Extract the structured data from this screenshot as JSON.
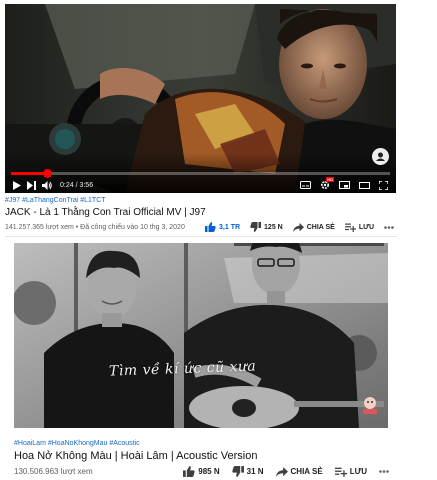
{
  "video1": {
    "progress": 0.096,
    "current_time": "0:24",
    "duration": "3:56",
    "hashtags": "#J97 #LaThangConTrai #L1TCT",
    "title": "JACK - Là 1 Thằng Con Trai Official MV | J97",
    "views": "141.257.365 lượt xem • Đã công chiếu vào 10 thg 3, 2020",
    "likes": "3,1 TR",
    "dislikes": "125 N",
    "share_label": "CHIA SẺ",
    "save_label": "LƯU",
    "colors": {
      "progress": "#ff0000",
      "link": "#1769c5",
      "like_active": "#065fd4"
    }
  },
  "video2": {
    "lyric_overlay": "Tìm về kí ức cũ xưa",
    "hashtags": "#HoaiLam #HoaNoKhongMau #Acoustic",
    "title": "Hoa Nở Không Màu | Hoài Lâm | Acoustic Version",
    "views": "130.506.963 lượt xem",
    "likes": "985 N",
    "dislikes": "31 N",
    "share_label": "CHIA SẺ",
    "save_label": "LƯU"
  }
}
